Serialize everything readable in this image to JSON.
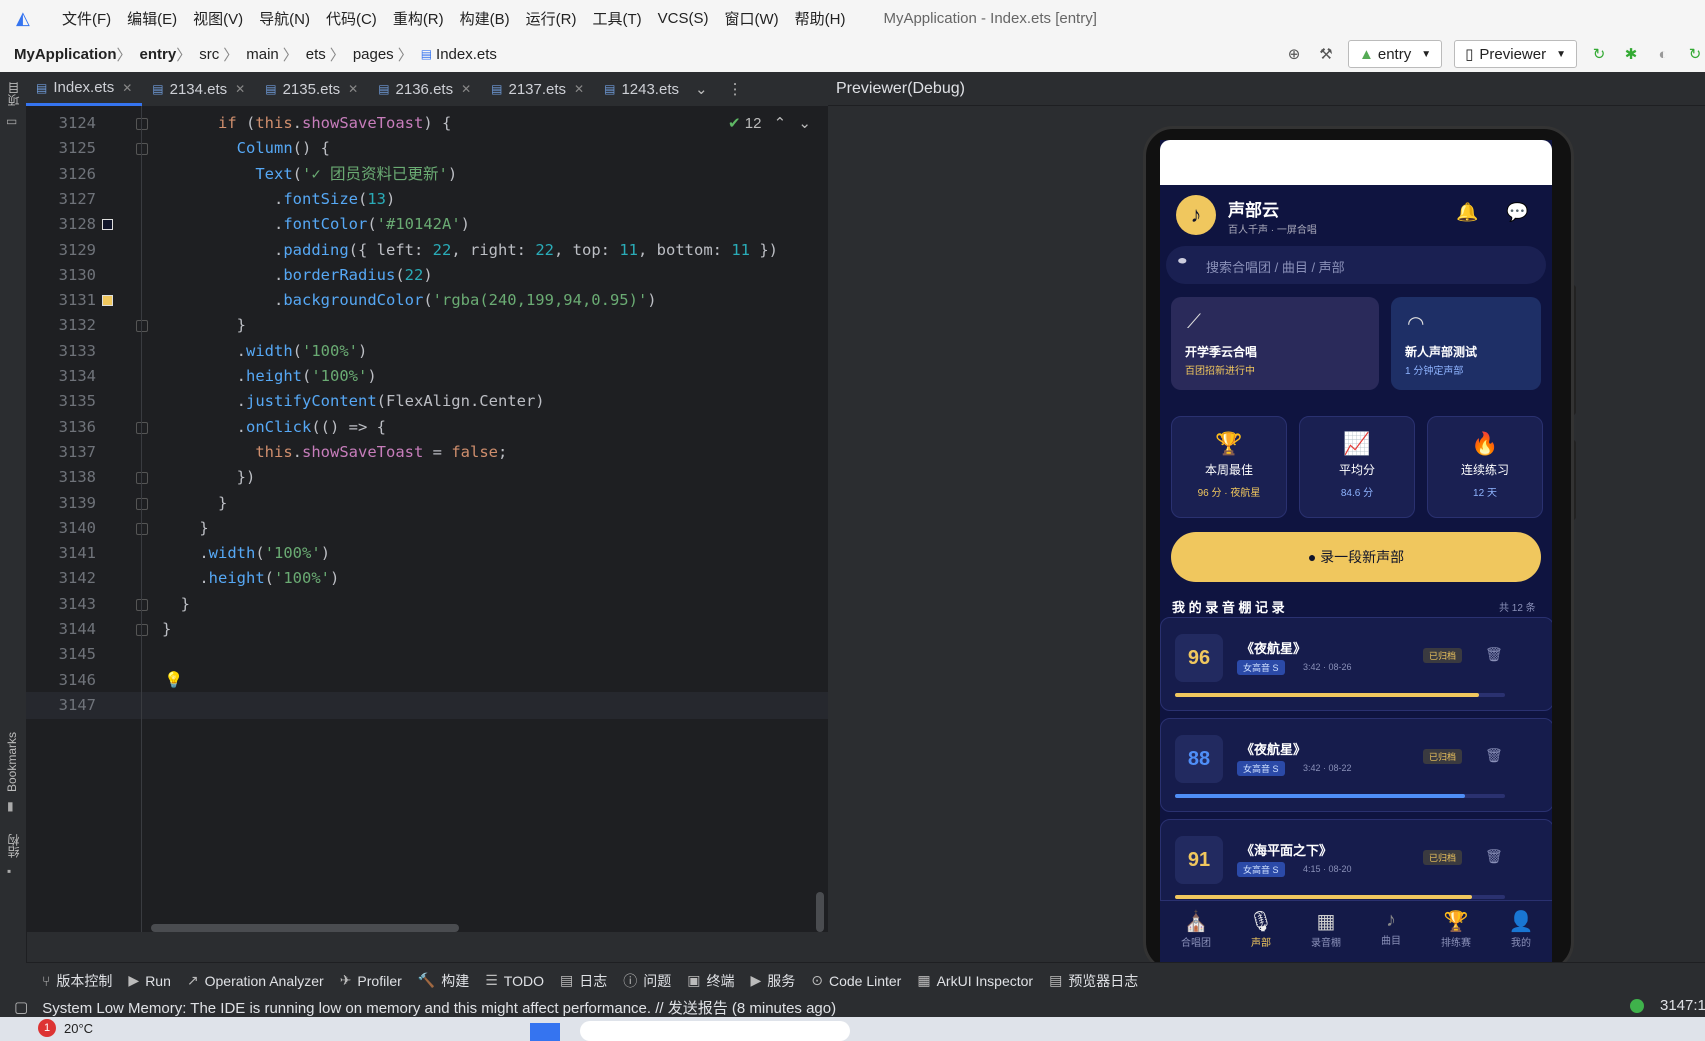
{
  "menu": {
    "items": [
      "文件(F)",
      "编辑(E)",
      "视图(V)",
      "导航(N)",
      "代码(C)",
      "重构(R)",
      "构建(B)",
      "运行(R)",
      "工具(T)",
      "VCS(S)",
      "窗口(W)",
      "帮助(H)"
    ],
    "window_title": "MyApplication - Index.ets [entry]"
  },
  "breadcrumb": [
    "MyApplication",
    "entry",
    "src",
    "main",
    "ets",
    "pages",
    "Index.ets"
  ],
  "toolbar": {
    "module": "entry",
    "previewer": "Previewer"
  },
  "tabs": [
    "Index.ets",
    "2134.ets",
    "2135.ets",
    "2136.ets",
    "2137.ets",
    "1243.ets"
  ],
  "inspections": "12",
  "code_lines": [
    {
      "n": "3124",
      "t": "      if (this.showSaveToast) {"
    },
    {
      "n": "3125",
      "t": "        Column() {"
    },
    {
      "n": "3126",
      "t": "          Text('✓ 团员资料已更新')"
    },
    {
      "n": "3127",
      "t": "            .fontSize(13)"
    },
    {
      "n": "3128",
      "t": "            .fontColor('#10142A')"
    },
    {
      "n": "3129",
      "t": "            .padding({ left: 22, right: 22, top: 11, bottom: 11 })"
    },
    {
      "n": "3130",
      "t": "            .borderRadius(22)"
    },
    {
      "n": "3131",
      "t": "            .backgroundColor('rgba(240,199,94,0.95)')"
    },
    {
      "n": "3132",
      "t": "        }"
    },
    {
      "n": "3133",
      "t": "        .width('100%')"
    },
    {
      "n": "3134",
      "t": "        .height('100%')"
    },
    {
      "n": "3135",
      "t": "        .justifyContent(FlexAlign.Center)"
    },
    {
      "n": "3136",
      "t": "        .onClick(() => {"
    },
    {
      "n": "3137",
      "t": "          this.showSaveToast = false;"
    },
    {
      "n": "3138",
      "t": "        })"
    },
    {
      "n": "3139",
      "t": "      }"
    },
    {
      "n": "3140",
      "t": "    }"
    },
    {
      "n": "3141",
      "t": "    .width('100%')"
    },
    {
      "n": "3142",
      "t": "    .height('100%')"
    },
    {
      "n": "3143",
      "t": "  }"
    },
    {
      "n": "3144",
      "t": "}"
    },
    {
      "n": "3145",
      "t": ""
    },
    {
      "n": "3146",
      "t": ""
    },
    {
      "n": "3147",
      "t": ""
    }
  ],
  "preview": {
    "title": "Previewer(Debug)",
    "app": {
      "name": "声部云",
      "subtitle": "百人千声 · 一屏合唱",
      "search_placeholder": "搜索合唱团 / 曲目 / 声部",
      "banners": [
        {
          "title": "开学季云合唱",
          "sub": "百团招新进行中"
        },
        {
          "title": "新人声部测试",
          "sub": "1 分钟定声部"
        }
      ],
      "stats": [
        {
          "icon": "🏆",
          "label": "本周最佳",
          "value": "96 分 · 夜航星"
        },
        {
          "icon": "📈",
          "label": "平均分",
          "value": "84.6 分"
        },
        {
          "icon": "🔥",
          "label": "连续练习",
          "value": "12 天"
        }
      ],
      "record_button": "录一段新声部",
      "section_title": "我 的 录 音 棚 记 录",
      "section_count": "共 12 条",
      "records": [
        {
          "score": "96",
          "title": "《夜航星》",
          "tag": "女高音 S",
          "meta": "3:42 · 08-26",
          "status": "已归档",
          "progress": 0.92,
          "color": "#f0c75e"
        },
        {
          "score": "88",
          "title": "《夜航星》",
          "tag": "女高音 S",
          "meta": "3:42 · 08-22",
          "status": "已归档",
          "progress": 0.88,
          "color": "#4f8ef7"
        },
        {
          "score": "91",
          "title": "《海平面之下》",
          "tag": "女高音 S",
          "meta": "4:15 · 08-20",
          "status": "已归档",
          "progress": 0.9,
          "color": "#f0c75e"
        }
      ],
      "nav": [
        "合唱团",
        "声部",
        "录音棚",
        "曲目",
        "排练赛",
        "我的"
      ]
    }
  },
  "toolwindows": [
    "版本控制",
    "Run",
    "Operation Analyzer",
    "Profiler",
    "构建",
    "TODO",
    "日志",
    "问题",
    "终端",
    "服务",
    "Code Linter",
    "ArkUI Inspector",
    "预览器日志"
  ],
  "status_message": "System Low Memory: The IDE is running low on memory and this might affect performance. // 发送报告 (8 minutes ago)",
  "cursor_pos": "3147:1",
  "side_labels": {
    "project": "项目",
    "bookmarks": "Bookmarks",
    "structure": "结构"
  },
  "weather": "20°C"
}
